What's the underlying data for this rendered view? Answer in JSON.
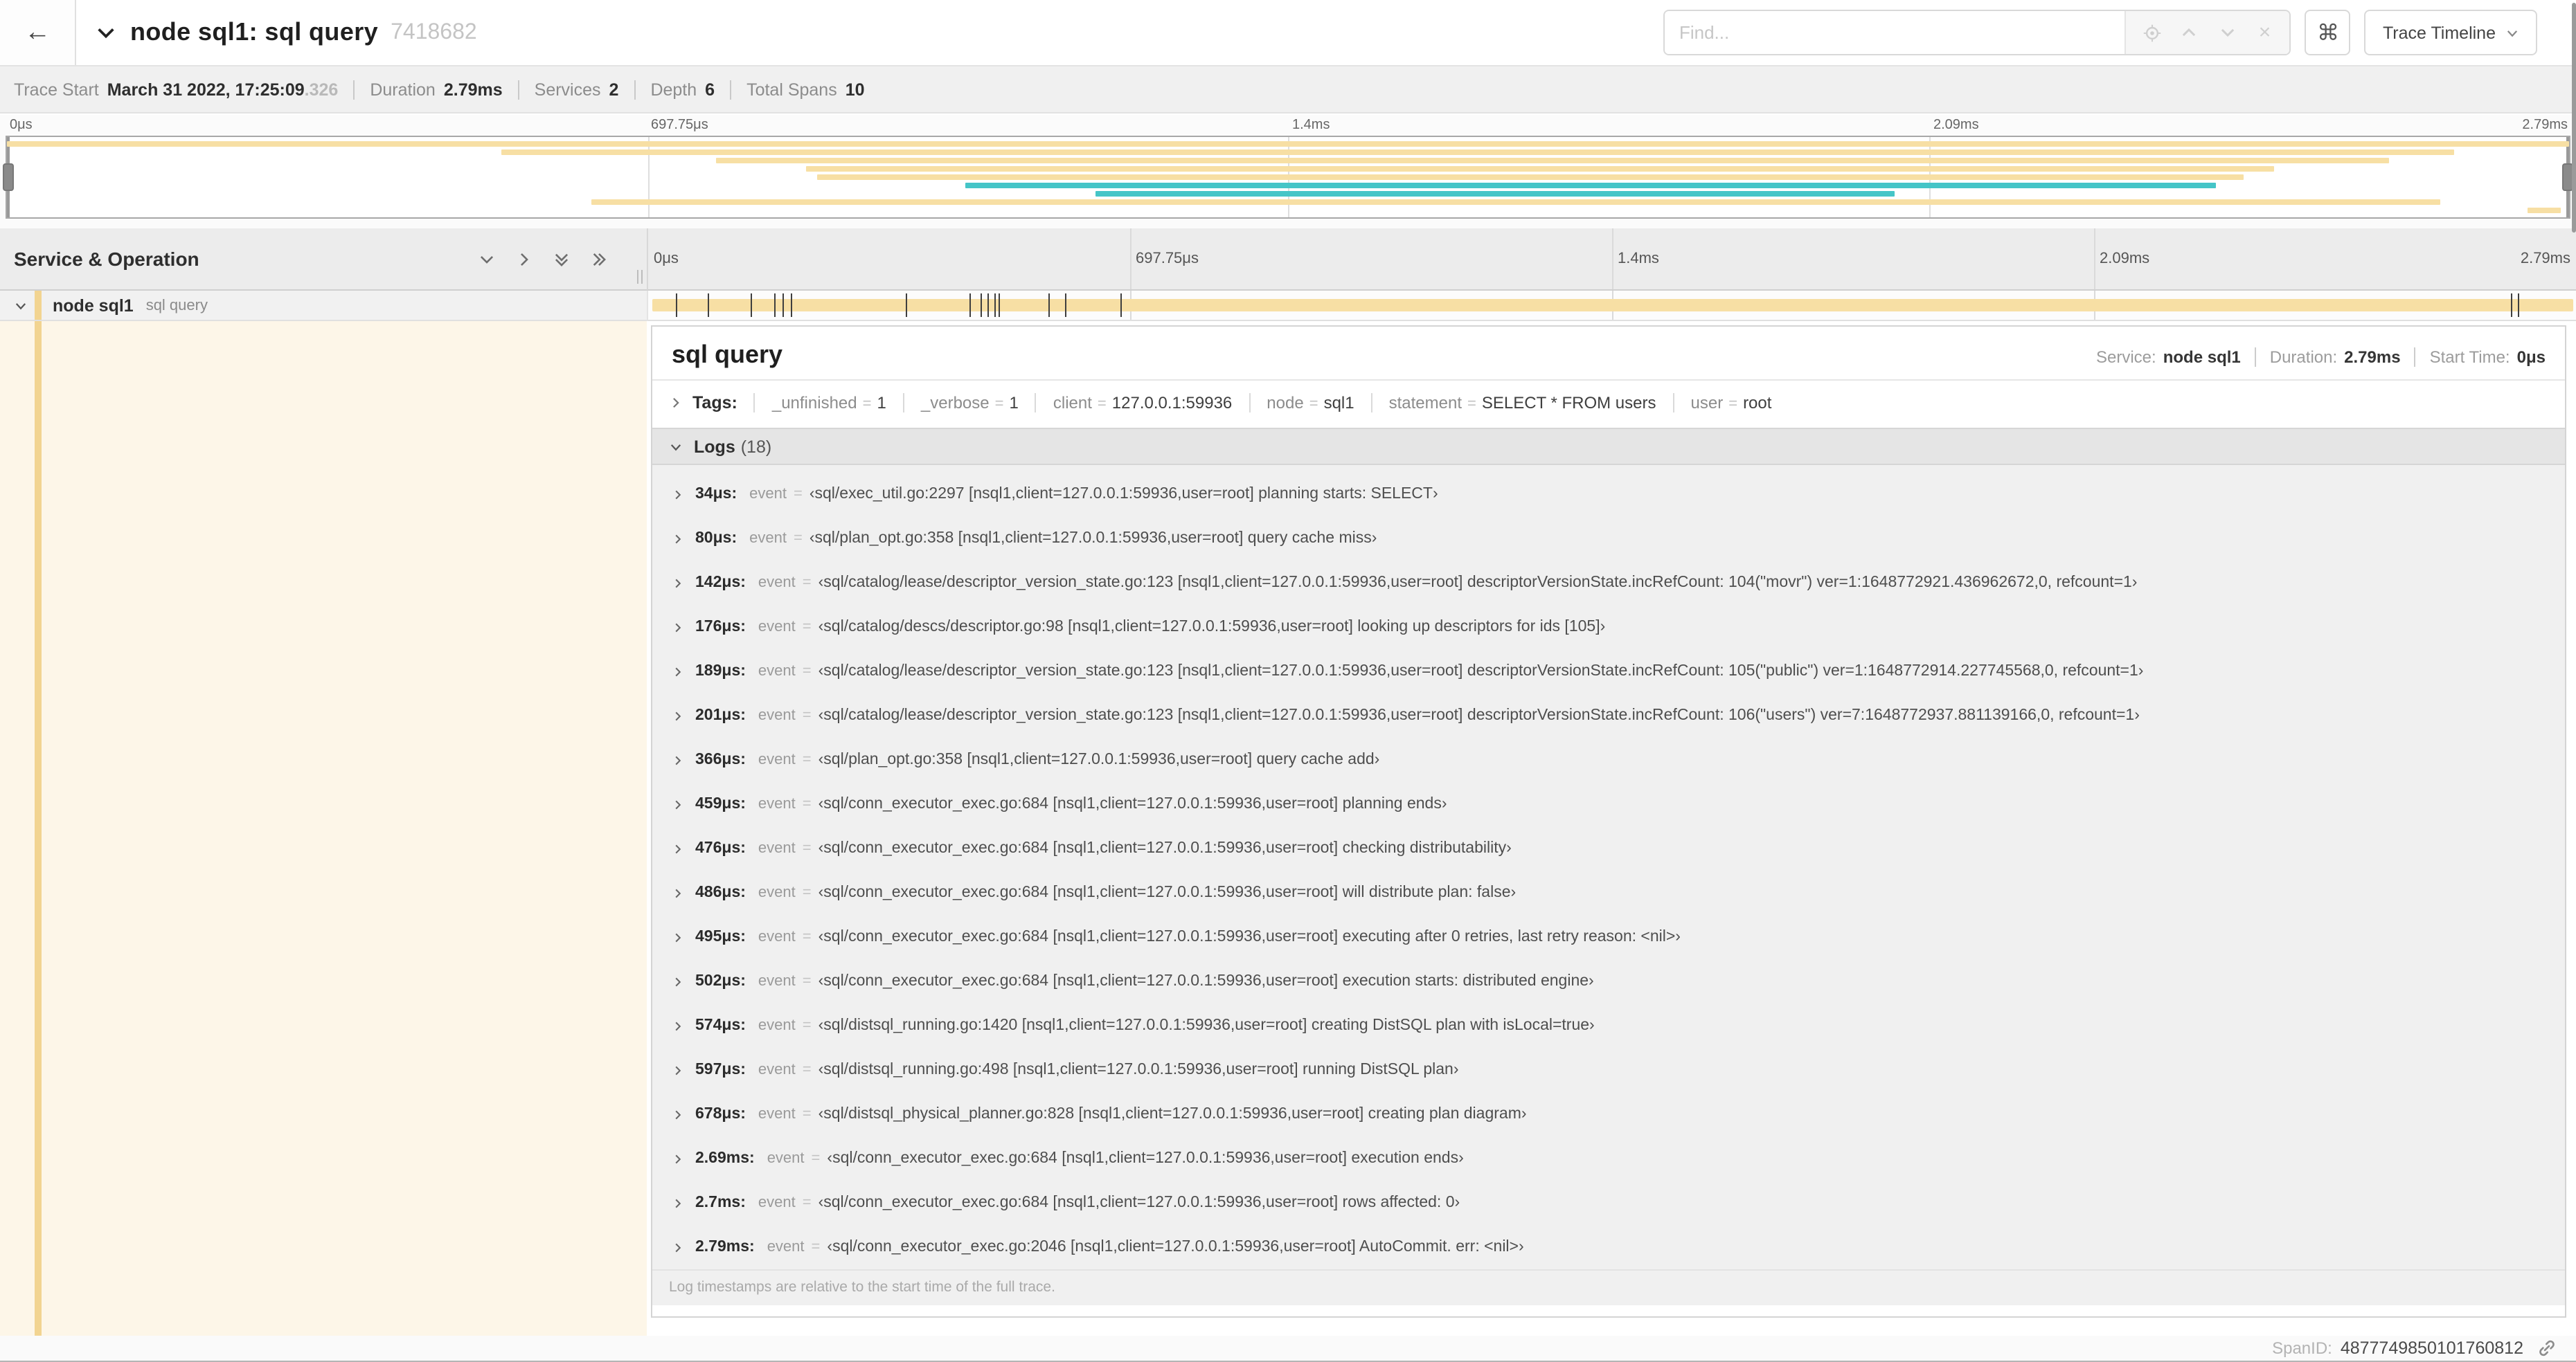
{
  "colors": {
    "amber": "#f7dfa4",
    "amber_accent": "#f2d491",
    "teal": "#45c5c7",
    "detail_row_bg": "#fdf6e8"
  },
  "header": {
    "back_icon": "←",
    "title": "node sql1: sql query",
    "trace_id_short": "7418682",
    "find_placeholder": "Find...",
    "shortcut_label": "⌘",
    "view_selector_label": "Trace Timeline"
  },
  "trace_info": {
    "items": [
      {
        "label": "Trace Start",
        "value": "March 31 2022, 17:25:09",
        "suffix": ".326"
      },
      {
        "label": "Duration",
        "value": "2.79ms",
        "suffix": ""
      },
      {
        "label": "Services",
        "value": "2",
        "suffix": ""
      },
      {
        "label": "Depth",
        "value": "6",
        "suffix": ""
      },
      {
        "label": "Total Spans",
        "value": "10",
        "suffix": ""
      }
    ]
  },
  "minimap": {
    "ticks": [
      "0μs",
      "697.75μs",
      "1.4ms",
      "2.09ms",
      "2.79ms"
    ],
    "spans": [
      {
        "start": 0,
        "end": 100,
        "color": "amber"
      },
      {
        "start": 19.3,
        "end": 95.5,
        "color": "amber"
      },
      {
        "start": 27.7,
        "end": 93,
        "color": "amber"
      },
      {
        "start": 31.2,
        "end": 88.5,
        "color": "amber"
      },
      {
        "start": 31.6,
        "end": 87.3,
        "color": "amber"
      },
      {
        "start": 37.4,
        "end": 86.2,
        "color": "teal"
      },
      {
        "start": 42.5,
        "end": 73.7,
        "color": "teal"
      },
      {
        "start": 22.8,
        "end": 95,
        "color": "amber"
      },
      {
        "start": 98.4,
        "end": 99.7,
        "color": "amber"
      }
    ]
  },
  "timeline": {
    "left_header": "Service & Operation",
    "ticks": [
      "0μs",
      "697.75μs",
      "1.4ms",
      "2.09ms",
      "2.79ms"
    ],
    "row": {
      "service": "node sql1",
      "operation": "sql query"
    },
    "total_us": 2790
  },
  "detail": {
    "title": "sql query",
    "overview": [
      {
        "label": "Service:",
        "value": "node sql1"
      },
      {
        "label": "Duration:",
        "value": "2.79ms"
      },
      {
        "label": "Start Time:",
        "value": "0μs"
      }
    ],
    "tags_label": "Tags:",
    "tags": [
      {
        "key": "_unfinished",
        "value": "1"
      },
      {
        "key": "_verbose",
        "value": "1"
      },
      {
        "key": "client",
        "value": "127.0.0.1:59936"
      },
      {
        "key": "node",
        "value": "sql1"
      },
      {
        "key": "statement",
        "value": "SELECT * FROM users"
      },
      {
        "key": "user",
        "value": "root"
      }
    ],
    "logs_label": "Logs",
    "logs_count": "(18)",
    "logs": [
      {
        "time": "34μs:",
        "t_us": 34,
        "key": "event",
        "value": "‹sql/exec_util.go:2297 [nsql1,client=127.0.0.1:59936,user=root] planning starts: SELECT›"
      },
      {
        "time": "80μs:",
        "t_us": 80,
        "key": "event",
        "value": "‹sql/plan_opt.go:358 [nsql1,client=127.0.0.1:59936,user=root] query cache miss›"
      },
      {
        "time": "142μs:",
        "t_us": 142,
        "key": "event",
        "value": "‹sql/catalog/lease/descriptor_version_state.go:123 [nsql1,client=127.0.0.1:59936,user=root] descriptorVersionState.incRefCount: 104(\"movr\") ver=1:1648772921.436962672,0, refcount=1›"
      },
      {
        "time": "176μs:",
        "t_us": 176,
        "key": "event",
        "value": "‹sql/catalog/descs/descriptor.go:98 [nsql1,client=127.0.0.1:59936,user=root] looking up descriptors for ids [105]›"
      },
      {
        "time": "189μs:",
        "t_us": 189,
        "key": "event",
        "value": "‹sql/catalog/lease/descriptor_version_state.go:123 [nsql1,client=127.0.0.1:59936,user=root] descriptorVersionState.incRefCount: 105(\"public\") ver=1:1648772914.227745568,0, refcount=1›"
      },
      {
        "time": "201μs:",
        "t_us": 201,
        "key": "event",
        "value": "‹sql/catalog/lease/descriptor_version_state.go:123 [nsql1,client=127.0.0.1:59936,user=root] descriptorVersionState.incRefCount: 106(\"users\") ver=7:1648772937.881139166,0, refcount=1›"
      },
      {
        "time": "366μs:",
        "t_us": 366,
        "key": "event",
        "value": "‹sql/plan_opt.go:358 [nsql1,client=127.0.0.1:59936,user=root] query cache add›"
      },
      {
        "time": "459μs:",
        "t_us": 459,
        "key": "event",
        "value": "‹sql/conn_executor_exec.go:684 [nsql1,client=127.0.0.1:59936,user=root] planning ends›"
      },
      {
        "time": "476μs:",
        "t_us": 476,
        "key": "event",
        "value": "‹sql/conn_executor_exec.go:684 [nsql1,client=127.0.0.1:59936,user=root] checking distributability›"
      },
      {
        "time": "486μs:",
        "t_us": 486,
        "key": "event",
        "value": "‹sql/conn_executor_exec.go:684 [nsql1,client=127.0.0.1:59936,user=root] will distribute plan: false›"
      },
      {
        "time": "495μs:",
        "t_us": 495,
        "key": "event",
        "value": "‹sql/conn_executor_exec.go:684 [nsql1,client=127.0.0.1:59936,user=root] executing after 0 retries, last retry reason: <nil>›"
      },
      {
        "time": "502μs:",
        "t_us": 502,
        "key": "event",
        "value": "‹sql/conn_executor_exec.go:684 [nsql1,client=127.0.0.1:59936,user=root] execution starts: distributed engine›"
      },
      {
        "time": "574μs:",
        "t_us": 574,
        "key": "event",
        "value": "‹sql/distsql_running.go:1420 [nsql1,client=127.0.0.1:59936,user=root] creating DistSQL plan with isLocal=true›"
      },
      {
        "time": "597μs:",
        "t_us": 597,
        "key": "event",
        "value": "‹sql/distsql_running.go:498 [nsql1,client=127.0.0.1:59936,user=root] running DistSQL plan›"
      },
      {
        "time": "678μs:",
        "t_us": 678,
        "key": "event",
        "value": "‹sql/distsql_physical_planner.go:828 [nsql1,client=127.0.0.1:59936,user=root] creating plan diagram›"
      },
      {
        "time": "2.69ms:",
        "t_us": 2690,
        "key": "event",
        "value": "‹sql/conn_executor_exec.go:684 [nsql1,client=127.0.0.1:59936,user=root] execution ends›"
      },
      {
        "time": "2.7ms:",
        "t_us": 2700,
        "key": "event",
        "value": "‹sql/conn_executor_exec.go:684 [nsql1,client=127.0.0.1:59936,user=root] rows affected: 0›"
      },
      {
        "time": "2.79ms:",
        "t_us": 2790,
        "key": "event",
        "value": "‹sql/conn_executor_exec.go:2046 [nsql1,client=127.0.0.1:59936,user=root] AutoCommit. err: <nil>›"
      }
    ],
    "logs_note": "Log timestamps are relative to the start time of the full trace.",
    "footer": {
      "label": "SpanID:",
      "value": "4877749850101760812"
    }
  }
}
